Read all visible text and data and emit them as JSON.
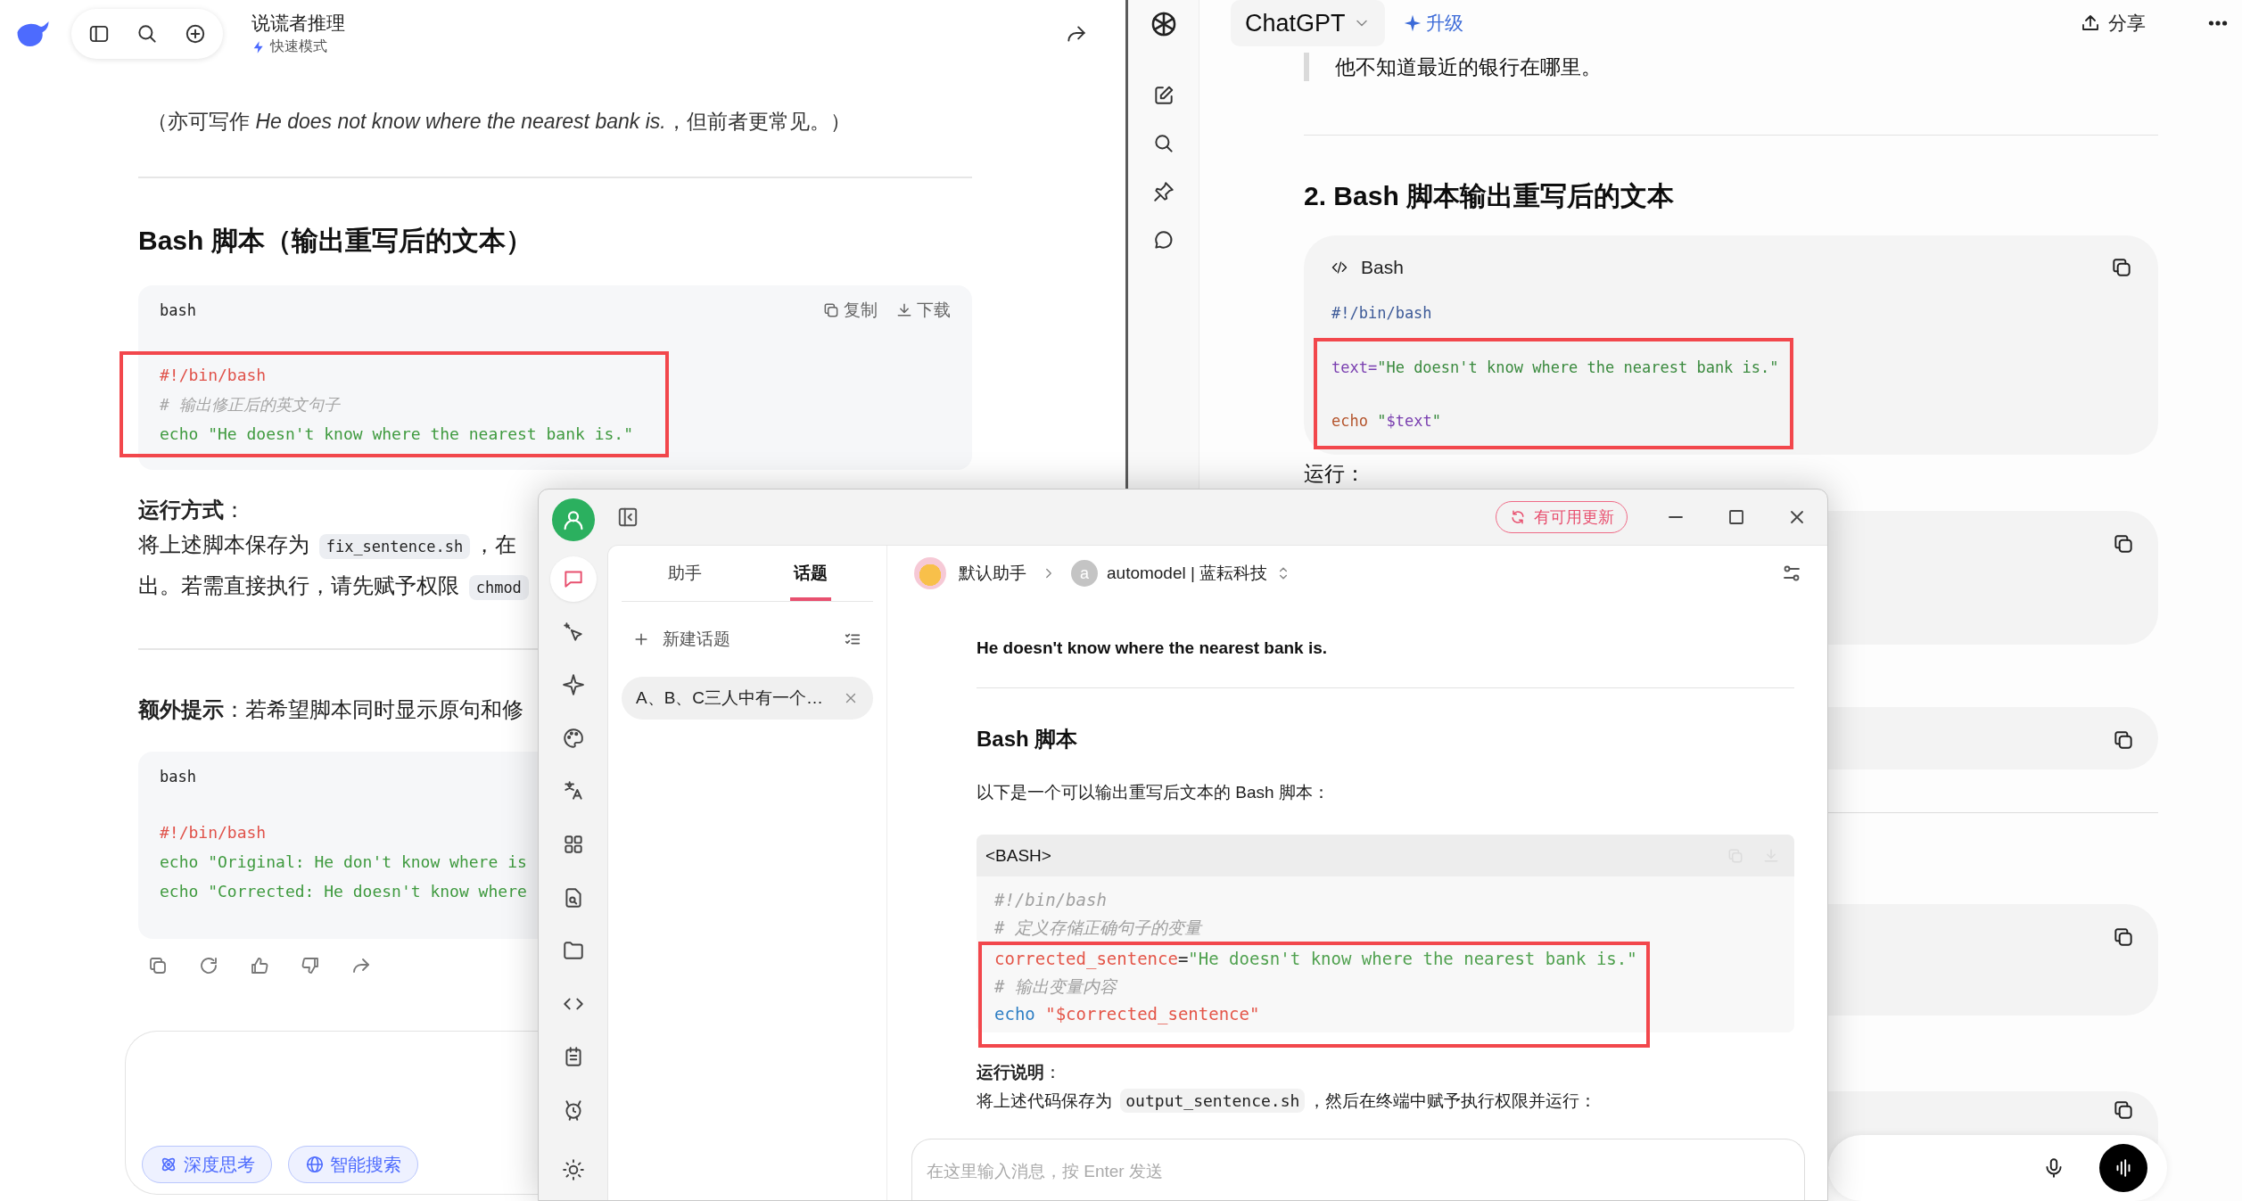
{
  "left_window": {
    "title": "说谎者推理",
    "mode": "快速模式",
    "content": [
      {
        "kind": "note",
        "text": "（亦可写作 *He does not know where the nearest bank is.*，但前者更常见。）"
      },
      {
        "kind": "rule"
      },
      {
        "kind": "heading",
        "text": "Bash 脚本（输出重写后的文本）"
      },
      {
        "kind": "code",
        "language": "bash",
        "copy_label": "复制",
        "download_label": "下载",
        "lines": [
          {
            "tokens": [
              {
                "text": "#!/bin/bash",
                "kind": "shebang"
              }
            ],
            "highlighted": true
          },
          {
            "tokens": [
              {
                "text": "# 输出修正后的英文句子",
                "kind": "comment"
              }
            ],
            "highlighted": true
          },
          {
            "tokens": [
              {
                "text": "echo \"He doesn't know where the nearest bank is.\"",
                "kind": "string"
              }
            ],
            "highlighted": true
          }
        ]
      },
      {
        "kind": "paragraph",
        "text": "**运行方式**："
      },
      {
        "kind": "lines",
        "lines": [
          [
            {
              "text": "将上述脚本保存为 ",
              "code": false
            },
            {
              "text": "fix_sentence.sh",
              "code": true
            },
            {
              "text": "，在",
              "code": false
            }
          ],
          [
            {
              "text": "出。若需直接执行，请先赋予权限 ",
              "code": false
            },
            {
              "text": "chmod",
              "code": true
            }
          ]
        ]
      },
      {
        "kind": "rule"
      },
      {
        "kind": "paragraph",
        "text": "**额外提示**：若希望脚本同时显示原句和修"
      },
      {
        "kind": "code",
        "language": "bash",
        "lines": [
          {
            "tokens": [
              {
                "text": "#!/bin/bash",
                "kind": "shebang"
              }
            ],
            "highlighted": false
          },
          {
            "tokens": [
              {
                "text": "echo \"Original: He don't know where is",
                "kind": "string"
              }
            ],
            "highlighted": false
          },
          {
            "tokens": [
              {
                "text": "echo \"Corrected: He doesn't know where",
                "kind": "string"
              }
            ],
            "highlighted": false
          }
        ]
      }
    ],
    "composer_buttons": [
      {
        "label": "深度思考",
        "selected": true
      },
      {
        "label": "智能搜索",
        "selected": true
      }
    ]
  },
  "right_window": {
    "title": "ChatGPT",
    "upgrade": "升级",
    "share": "分享",
    "quote": "他不知道最近的银行在哪里。",
    "heading": "2. Bash 脚本输出重写后的文本",
    "code": {
      "language": "Bash",
      "lines": [
        {
          "tokens": [
            {
              "text": "#!/bin/bash",
              "kind": "shebang"
            }
          ],
          "highlighted": false
        },
        {
          "tokens": [
            {
              "text": "text=",
              "kind": "variable"
            },
            {
              "text": "\"He doesn't know where the nearest bank is.\"",
              "kind": "string"
            }
          ],
          "highlighted": true
        },
        {
          "tokens": [
            {
              "text": "echo",
              "kind": "keyword"
            },
            {
              "text": " \"",
              "kind": "string"
            },
            {
              "text": "$text",
              "kind": "variable"
            },
            {
              "text": "\"",
              "kind": "string"
            }
          ],
          "highlighted": true
        }
      ]
    },
    "run_label": "运行：",
    "more": [
      {
        "kind": "code"
      },
      {
        "kind": "code"
      },
      {
        "kind": "rule"
      },
      {
        "kind": "code"
      },
      {
        "kind": "code"
      }
    ]
  },
  "floating_window": {
    "update": "有可用更新",
    "rail": [
      {
        "selected": true
      },
      {
        "selected": false
      },
      {
        "selected": false
      },
      {
        "selected": false
      },
      {
        "selected": false
      },
      {
        "selected": false
      },
      {
        "selected": false
      },
      {
        "selected": false
      },
      {
        "selected": false
      },
      {
        "selected": false
      },
      {
        "selected": false
      },
      {
        "selected": false
      }
    ],
    "tabs": [
      {
        "label": "助手",
        "selected": false
      },
      {
        "label": "话题",
        "selected": true
      }
    ],
    "new_topic": "新建话题",
    "topics": [
      {
        "title": "A、B、C三人中有一个…",
        "selected": true
      }
    ],
    "assistant": "默认助手",
    "model_initial": "a",
    "model": "automodel | 蓝耘科技",
    "messages": [
      {
        "kind": "answer",
        "text": "He doesn't know where the nearest bank is."
      },
      {
        "kind": "rule"
      },
      {
        "kind": "heading",
        "text": "Bash 脚本"
      },
      {
        "kind": "paragraph",
        "text": "以下是一个可以输出重写后文本的 Bash 脚本："
      },
      {
        "kind": "code",
        "language": "<BASH>",
        "lines": [
          {
            "tokens": [
              {
                "text": "#!/bin/bash",
                "kind": "comment"
              }
            ],
            "highlighted": false
          },
          {
            "tokens": [
              {
                "text": "# 定义存储正确句子的变量",
                "kind": "comment"
              }
            ],
            "highlighted": false
          },
          {
            "tokens": [
              {
                "text": "corrected_sentence",
                "kind": "variable"
              },
              {
                "text": "=",
                "kind": "plain"
              },
              {
                "text": "\"He doesn't know where the nearest bank is.\"",
                "kind": "string"
              }
            ],
            "highlighted": true
          },
          {
            "tokens": [
              {
                "text": "# 输出变量内容",
                "kind": "comment"
              }
            ],
            "highlighted": true
          },
          {
            "tokens": [
              {
                "text": "echo ",
                "kind": "keyword"
              },
              {
                "text": "\"$corrected_sentence\"",
                "kind": "variable"
              }
            ],
            "highlighted": true
          }
        ]
      },
      {
        "kind": "paragraph",
        "text": "**运行说明**："
      },
      {
        "kind": "lines",
        "lines": [
          [
            {
              "text": "将上述代码保存为 ",
              "code": false
            },
            {
              "text": "output_sentence.sh",
              "code": true
            },
            {
              "text": "，然后在终端中赋予执行权限并运行：",
              "code": false
            }
          ]
        ]
      }
    ],
    "placeholder": "在这里输入消息，按 Enter 发送"
  }
}
